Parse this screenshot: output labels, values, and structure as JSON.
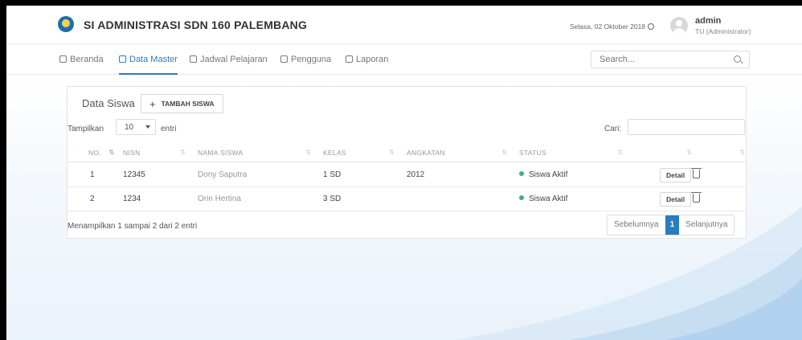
{
  "app": {
    "title": "SI ADMINISTRASI SDN 160 PALEMBANG",
    "date": "Selasa, 02 Oktober 2018",
    "user_name": "admin",
    "user_role": "TU (Administrator)"
  },
  "nav": {
    "items": [
      {
        "label": "Beranda",
        "icon": "home-icon"
      },
      {
        "label": "Data Master",
        "icon": "database-icon"
      },
      {
        "label": "Jadwal Pelajaran",
        "icon": "calendar-icon"
      },
      {
        "label": "Pengguna",
        "icon": "users-icon"
      },
      {
        "label": "Laporan",
        "icon": "copy-icon"
      }
    ],
    "active": "Data Master",
    "search_placeholder": "Search..."
  },
  "card": {
    "title": "Data Siswa",
    "add_label": "TAMBAH SISWA",
    "show_label": "Tampilkan",
    "page_size": "10",
    "entries_label": "entri",
    "search_label": "Cari:"
  },
  "table": {
    "columns": [
      "NO.",
      "NISN",
      "NAMA SISWA",
      "KELAS",
      "ANGKATAN",
      "STATUS"
    ],
    "rows": [
      {
        "no": "1",
        "nisn": "12345",
        "nama": "Dony Saputra",
        "kelas": "1 SD",
        "angkatan": "2012",
        "status": "Siswa Aktif",
        "action": "Detail"
      },
      {
        "no": "2",
        "nisn": "1234",
        "nama": "Orin Hertina",
        "kelas": "3 SD",
        "angkatan": "",
        "status": "Siswa Aktif",
        "action": "Detail"
      }
    ]
  },
  "footer": {
    "info": "Menampilkan 1 sampai 2 dari 2 entri",
    "prev": "Sebelumnya",
    "page": "1",
    "next": "Selanjutnya"
  },
  "colors": {
    "accent": "#2a7bc0",
    "status_active": "#3cb371"
  }
}
